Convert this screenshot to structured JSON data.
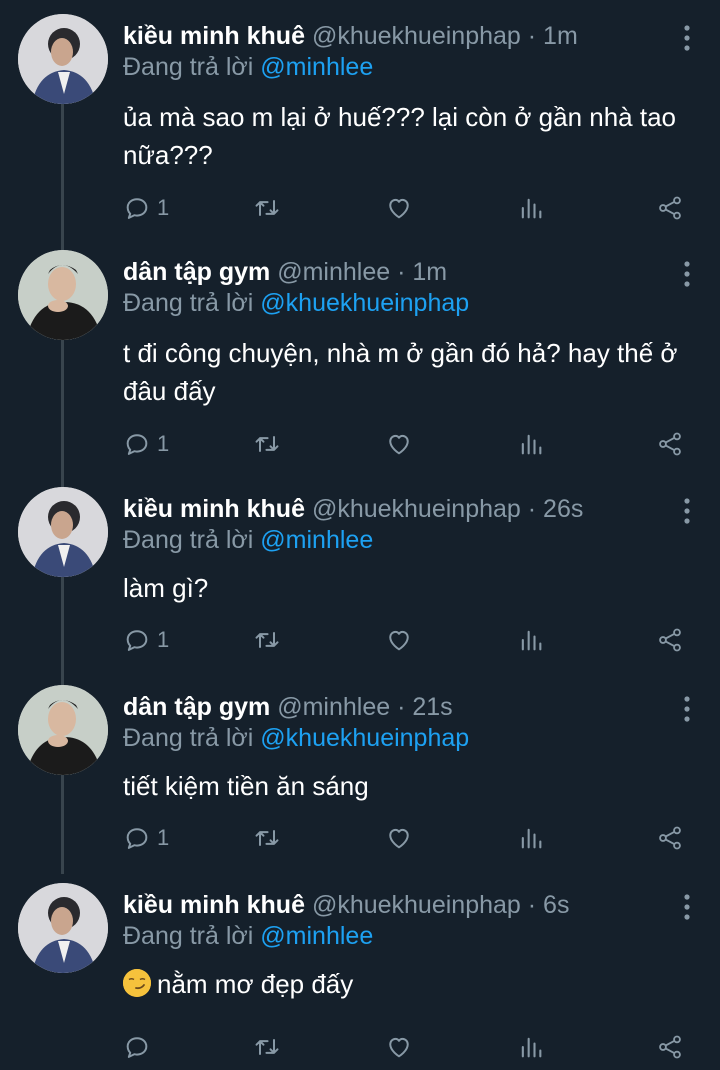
{
  "reply_prefix": "Đang trả lời",
  "tweets": [
    {
      "name": "kiều minh khuê",
      "handle": "@khuekhueinphap",
      "separator": "·",
      "time": "1m",
      "reply_to": "@minhlee",
      "text": "ủa mà sao m lại ở huế??? lại còn ở gần nhà tao nữa???",
      "reply_count": "1"
    },
    {
      "name": "dân tập gym",
      "handle": "@minhlee",
      "separator": "·",
      "time": "1m",
      "reply_to": "@khuekhueinphap",
      "text": "t đi công chuyện, nhà m ở gần đó hả? hay thế ở đâu đấy",
      "reply_count": "1"
    },
    {
      "name": "kiều minh khuê",
      "handle": "@khuekhueinphap",
      "separator": "·",
      "time": "26s",
      "reply_to": "@minhlee",
      "text": "làm gì?",
      "reply_count": "1"
    },
    {
      "name": "dân tập gym",
      "handle": "@minhlee",
      "separator": "·",
      "time": "21s",
      "reply_to": "@khuekhueinphap",
      "text": "tiết kiệm tiền ăn sáng",
      "reply_count": "1"
    },
    {
      "name": "kiều minh khuê",
      "handle": "@khuekhueinphap",
      "separator": "·",
      "time": "6s",
      "reply_to": "@minhlee",
      "text": "nằm mơ đẹp đấy",
      "text_emoji": "smirking-face",
      "reply_count": ""
    }
  ],
  "colors": {
    "background": "#15202b",
    "secondary_text": "#8899a6",
    "mention": "#1da1f2",
    "thread_line": "#38444d"
  },
  "icons": [
    "reply-icon",
    "retweet-icon",
    "like-icon",
    "stats-icon",
    "share-icon",
    "more-icon"
  ]
}
